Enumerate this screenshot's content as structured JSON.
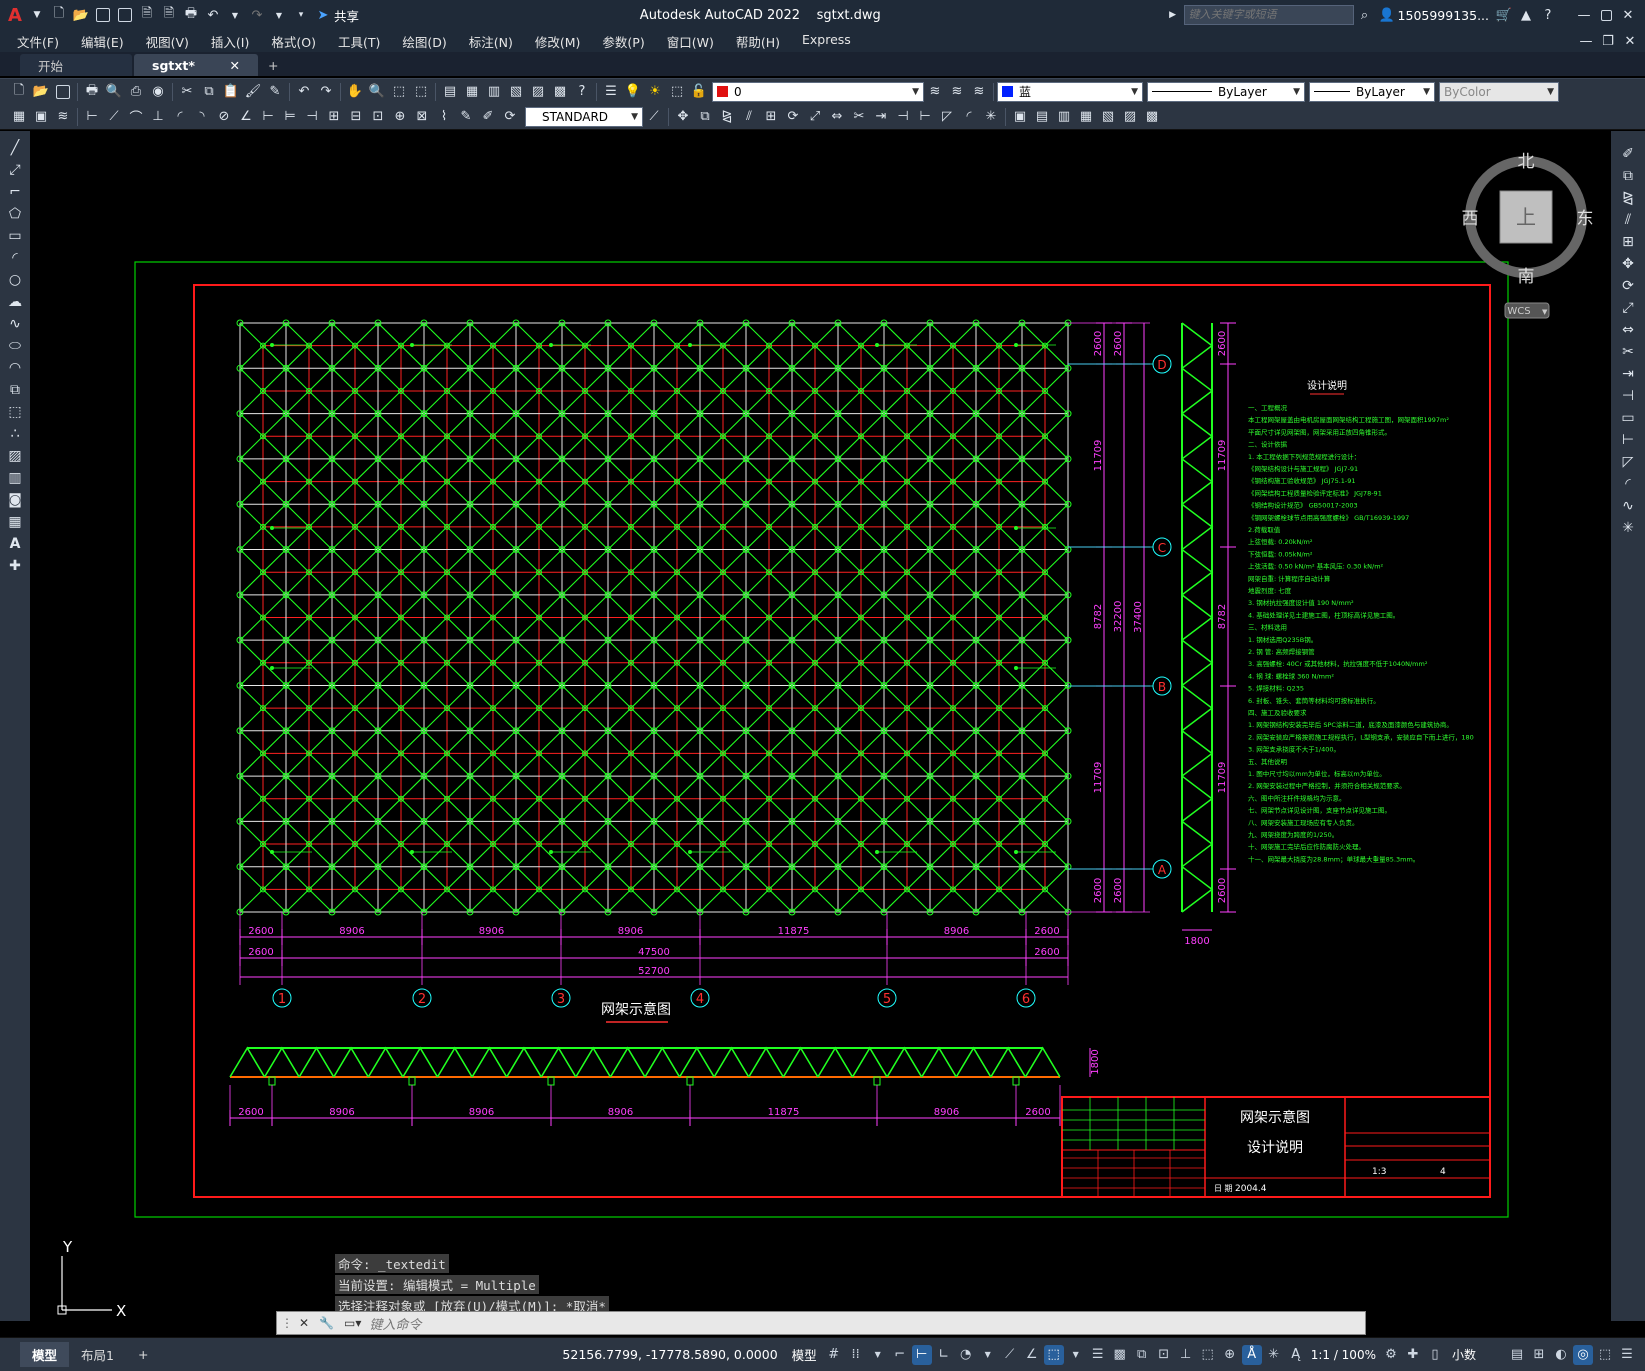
{
  "app": {
    "title": "Autodesk AutoCAD 2022",
    "file": "sgtxt.dwg",
    "share": "共享"
  },
  "search": {
    "placeholder": "键入关键字或短语"
  },
  "user": {
    "name": "1505999135..."
  },
  "menu": [
    "文件(F)",
    "编辑(E)",
    "视图(V)",
    "插入(I)",
    "格式(O)",
    "工具(T)",
    "绘图(D)",
    "标注(N)",
    "修改(M)",
    "参数(P)",
    "窗口(W)",
    "帮助(H)",
    "Express"
  ],
  "tabs": [
    {
      "label": "开始",
      "active": false
    },
    {
      "label": "sgtxt*",
      "active": true
    }
  ],
  "toolbar": {
    "layer": "0",
    "color": "蓝",
    "linetype": "ByLayer",
    "lineweight": "ByLayer",
    "plotstyle": "ByColor",
    "textstyle": "STANDARD"
  },
  "viewcube": {
    "north": "北",
    "south": "南",
    "east": "东",
    "west": "西",
    "top": "上",
    "wcs": "WCS"
  },
  "drawing": {
    "grid_cols": [
      "1",
      "2",
      "3",
      "4",
      "5",
      "6"
    ],
    "grid_rows": [
      "D",
      "C",
      "B",
      "A"
    ],
    "top_dims_1": [
      "2600",
      "8906",
      "8906",
      "8906",
      "11875",
      "8906",
      "2600"
    ],
    "top_dims_2": [
      "2600",
      "47500",
      "2600"
    ],
    "total_dim": "52700",
    "right_dims": [
      "2600",
      "11709",
      "8782",
      "11709",
      "2600"
    ],
    "right_sub": [
      "2600",
      "32200",
      "37400",
      "2600"
    ],
    "side_width": "1800",
    "plan_title": "网架示意图",
    "elev_dims": [
      "2600",
      "8906",
      "8906",
      "8906",
      "11875",
      "8906",
      "2600"
    ],
    "elev_height": "1800",
    "notes_title": "设计说明",
    "notes": [
      "一、工程概况",
      "    本工程网架屋盖由电机房屋面网架结构工程施工图，网架面积1997m²",
      "    平面尺寸详见网架图，网架采用正放四角锥形式。",
      "二、设计依据",
      "  1. 本工程依据下列规范规程进行设计：",
      "    《网架结构设计与施工规程》        JGJ7-91",
      "    《钢结构施工验收规范》            JGJ75.1-91",
      "    《网架结构工程质量检验评定标准》  JGJ78-91",
      "    《钢结构设计规范》                GB50017-2003",
      "    《钢网架螺栓球节点用高强度螺栓》  GB/T16939-1997",
      "  2.荷载取值",
      "    上弦恒载:   0.20kN/m²",
      "    下弦恒载:   0.05kN/m²",
      "    上弦活载:   0.50 kN/m² 基本风压:  0.30 kN/m²",
      "    网架自重:   计算程序自动计算",
      "    地震烈度:   七度",
      "  3.  钢材抗拉强度设计值  190 N/mm²",
      "  4.  基础处理详见土建施工图，柱顶标高详见施工图。",
      "三、材料选用",
      "    1.  钢材选用Q235B钢。",
      "    2.  钢 管:      高频焊接钢管",
      "    3.  高强螺栓:   40Cr 或其他材料，抗拉强度不低于1040N/mm²",
      "    4.  钢 球:   螺栓球    360 N/mm²",
      "    5.  焊接材料:   Q235",
      "    6.  封板、锥头、套筒等材料均可按标准执行。",
      "四、施工及验收要求",
      "    1.  网架钢结构安装完毕后    SPC涂料二道，底漆及面漆颜色与建筑协商。",
      "    2.  网架安装应严格按照施工规程执行，L型钢支承，安装应自下而上进行，180",
      "    3.  网架支承挠度不大于1/400。",
      "五、其他说明",
      "    1.  图中尺寸均以mm为单位，标高以m为单位。",
      "    2.  网架安装过程中严格控制，并须符合相关规范要求。",
      "六、图中所注杆件规格均为示意。",
      "七、网架节点详见设计图，支座节点详见施工图。",
      "八、网架安装施工现场应有专人负责。",
      "九、网架挠度为跨度的1/250。",
      "十、网架施工完毕后应作防腐防火处理。",
      "十一、网架最大挠度为28.8mm；单球最大重量85.3mm。"
    ],
    "title_block": {
      "drawing_name_1": "网架示意图",
      "drawing_name_2": "设计说明",
      "date_label": "日 期",
      "date": "2004.4",
      "scale": "1:3",
      "sheet": "4"
    }
  },
  "cmd": {
    "history": [
      "命令:  _textedit",
      "当前设置: 编辑模式 = Multiple",
      "选择注释对象或 [放弃(U)/模式(M)]: *取消*"
    ],
    "placeholder": "键入命令"
  },
  "status": {
    "tabs": [
      "模型",
      "布局1"
    ],
    "coords": "52156.7799, -17778.5890, 0.0000",
    "space": "模型",
    "scale": "1:1 / 100%",
    "units": "小数"
  }
}
